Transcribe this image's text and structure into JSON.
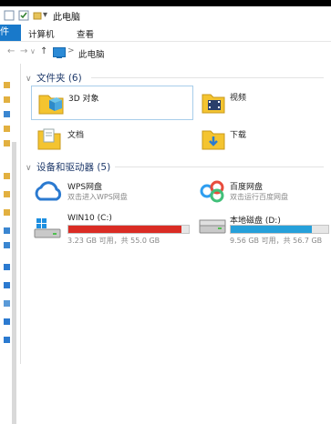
{
  "window": {
    "title": "此电脑"
  },
  "quick_access": {
    "glyph": "▾"
  },
  "ribbon": {
    "file_tab": "件",
    "tabs": [
      "计算机",
      "查看"
    ]
  },
  "address": {
    "back": "←",
    "forward": "→",
    "recent": "∨",
    "up": "↑",
    "separator": ">",
    "location": "此电脑"
  },
  "sections": {
    "folders": {
      "title": "文件夹 (6)"
    },
    "devices": {
      "title": "设备和驱动器 (5)"
    }
  },
  "folders": [
    {
      "name": "3D 对象",
      "icon": "3d-objects-icon"
    },
    {
      "name": "视频",
      "icon": "video-folder-icon"
    },
    {
      "name": "文档",
      "icon": "documents-folder-icon"
    },
    {
      "name": "下载",
      "icon": "downloads-folder-icon"
    }
  ],
  "devices": [
    {
      "name": "WPS网盘",
      "subtitle": "双击进入WPS网盘",
      "icon": "wps-cloud-icon"
    },
    {
      "name": "百度网盘",
      "subtitle": "双击运行百度网盘",
      "icon": "baidu-netdisk-icon"
    }
  ],
  "drives": [
    {
      "name": "WIN10 (C:)",
      "space": "3.23 GB 可用，共 55.0 GB",
      "used_fraction": 0.94,
      "bar_color": "#da2c24"
    },
    {
      "name": "本地磁盘 (D:)",
      "space": "9.56 GB 可用，共 56.7 GB",
      "used_fraction": 0.83,
      "bar_color": "#26a0da"
    }
  ],
  "colors": {
    "file_tab": "#1979ca",
    "folder_yellow": "#f4c430"
  }
}
